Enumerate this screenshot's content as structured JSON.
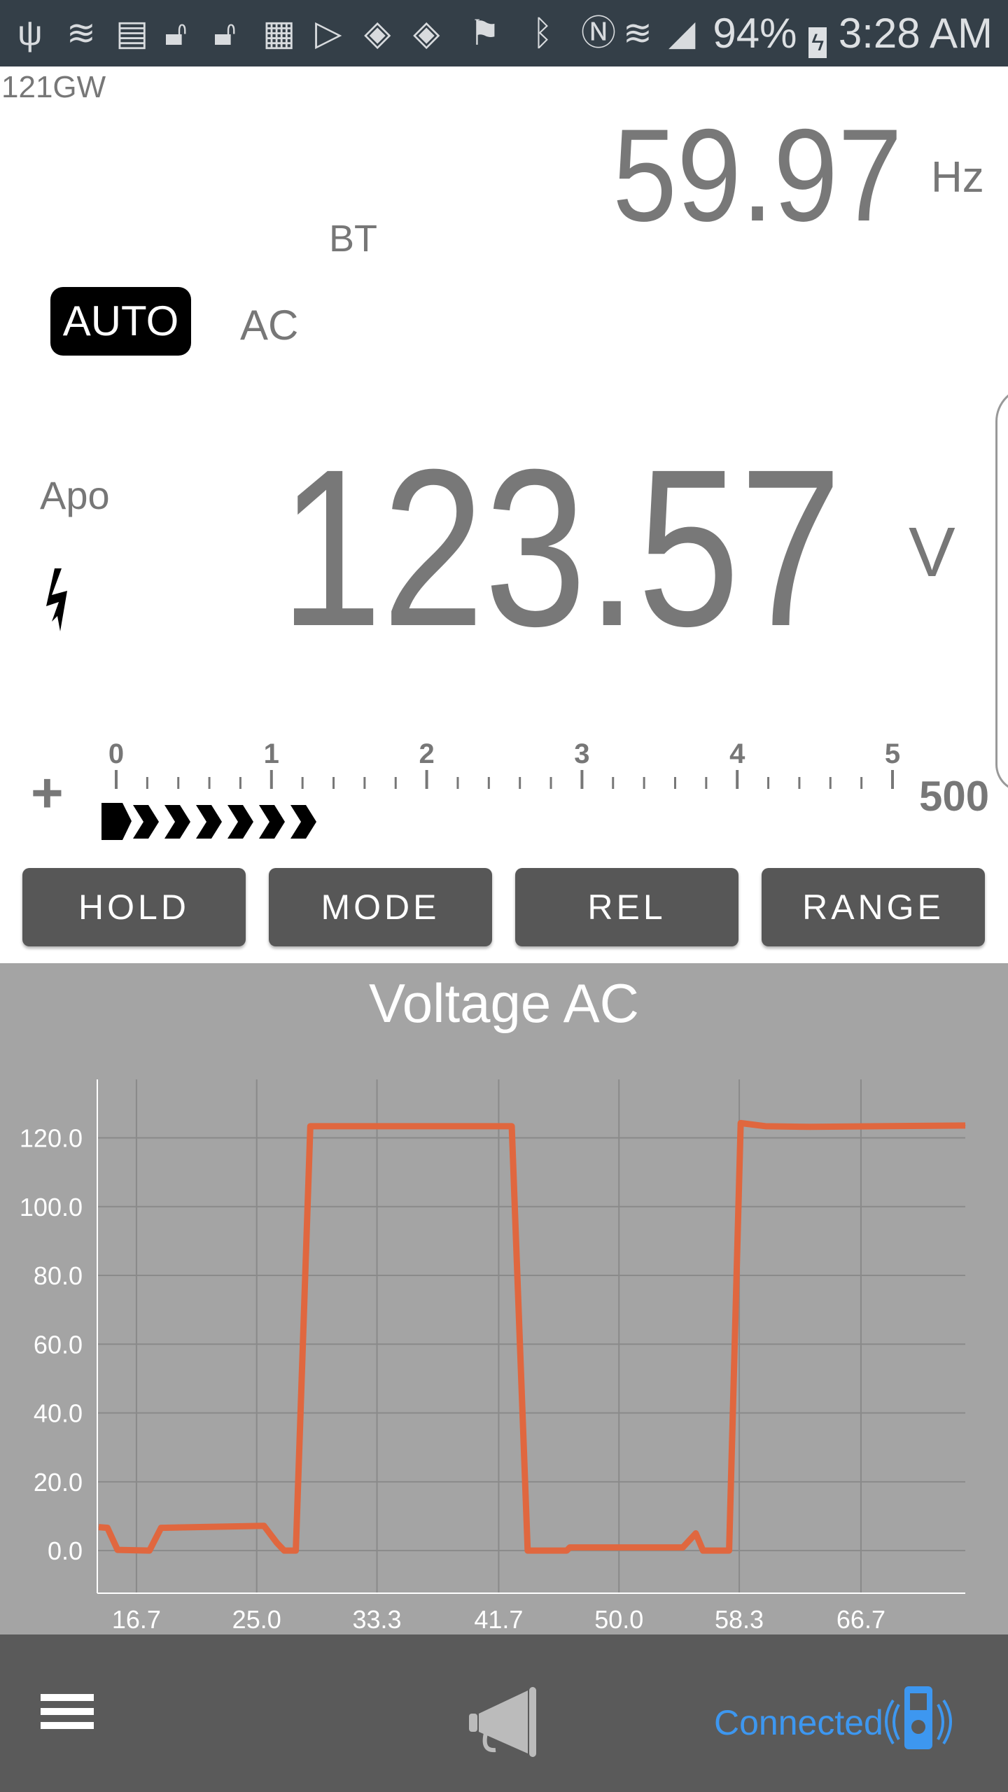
{
  "status_bar": {
    "icons": [
      "usb-icon",
      "wifi-icon",
      "calendar-icon",
      "lock-open-icon",
      "lock-open-icon",
      "sim-x-icon",
      "play-store-icon",
      "vpn-shield-icon",
      "vpn-shield-icon",
      "flag-icon",
      "bluetooth-icon",
      "nfc-icon",
      "wifi-data-icon",
      "signal-icon",
      "battery-charging-icon"
    ],
    "battery": "94%",
    "time": "3:28 AM"
  },
  "meter": {
    "model": "121GW",
    "secondary_value": "59.97",
    "secondary_unit": "Hz",
    "bt_label": "BT",
    "auto_label": "AUTO",
    "ac_label": "AC",
    "apo_label": "Apo",
    "main_value": "123.57",
    "main_unit": "V",
    "high_voltage_icon": "lightning-icon"
  },
  "bargraph": {
    "scale_labels": [
      "0",
      "1",
      "2",
      "3",
      "4",
      "5"
    ],
    "range_label": "500",
    "sign": "+",
    "fraction": 0.247
  },
  "buttons": {
    "hold": "HOLD",
    "mode": "MODE",
    "rel": "REL",
    "range": "RANGE"
  },
  "chart_data": {
    "type": "line",
    "title": "Voltage AC",
    "xlabel": "",
    "ylabel": "",
    "xlim": [
      14.0,
      73.9
    ],
    "ylim": [
      -12.4,
      137
    ],
    "xticks": [
      "16.7",
      "25.0",
      "33.3",
      "41.7",
      "50.0",
      "58.3",
      "66.7"
    ],
    "yticks": [
      "0.0",
      "20.0",
      "40.0",
      "60.0",
      "80.0",
      "100.0",
      "120.0"
    ],
    "grid": true,
    "color": "#e0673f",
    "x": [
      14.1,
      14.7,
      15.4,
      17.6,
      18.4,
      25.5,
      26.4,
      26.9,
      27.7,
      28.7,
      42.6,
      43.7,
      46.4,
      46.6,
      54.4,
      55.3,
      55.8,
      57.6,
      58.4,
      60.1,
      63.2,
      73.9
    ],
    "y": [
      6.8,
      6.6,
      0.2,
      0,
      6.6,
      7.2,
      2.2,
      0,
      0,
      123.4,
      123.4,
      0,
      0,
      0.9,
      0.9,
      5,
      0,
      0,
      124.3,
      123.4,
      123.2,
      123.6
    ]
  },
  "bottom_bar": {
    "menu_icon": "hamburger-icon",
    "beep_icon": "megaphone-icon",
    "connection_status": "Connected",
    "device_icon": "multimeter-wireless-icon",
    "accent": "#3d97f0"
  }
}
